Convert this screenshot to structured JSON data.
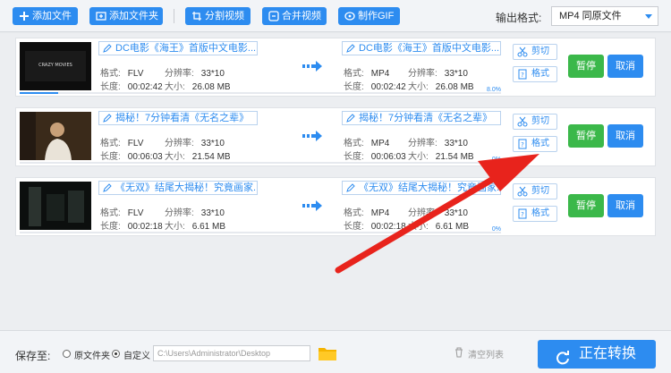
{
  "toolbar": {
    "add_file": "添加文件",
    "add_folder": "添加文件夹",
    "split_video": "分割视频",
    "merge_video": "合并视频",
    "make_gif": "制作GIF",
    "output_format_label": "输出格式:",
    "output_format_value": "MP4  同原文件"
  },
  "labels": {
    "format": "格式:",
    "resolution": "分辨率:",
    "duration": "长度:",
    "size": "大小:",
    "cut": "剪切",
    "format_btn": "格式",
    "pause": "暂停",
    "cancel": "取消"
  },
  "rows": [
    {
      "src_title": "DC电影《海王》首版中文电影...",
      "dst_title": "DC电影《海王》首版中文电影...",
      "src": {
        "format": "FLV",
        "resolution": "33*10",
        "duration": "00:02:42",
        "size": "26.08 MB"
      },
      "dst": {
        "format": "MP4",
        "resolution": "33*10",
        "duration": "00:02:42",
        "size": "26.08 MB"
      },
      "progress_text": "8.0%",
      "progress": 0.08,
      "thumb_caption": "CRAZY MOVIES"
    },
    {
      "src_title": "揭秘！7分钟看清《无名之辈》",
      "dst_title": "揭秘！7分钟看清《无名之辈》",
      "src": {
        "format": "FLV",
        "resolution": "33*10",
        "duration": "00:06:03",
        "size": "21.54 MB"
      },
      "dst": {
        "format": "MP4",
        "resolution": "33*10",
        "duration": "00:06:03",
        "size": "21.54 MB"
      },
      "progress_text": "0%",
      "progress": 0.0,
      "thumb_caption": ""
    },
    {
      "src_title": "《无双》结尾大揭秘！究竟画家.",
      "dst_title": "《无双》结尾大揭秘！究竟画家.",
      "src": {
        "format": "FLV",
        "resolution": "33*10",
        "duration": "00:02:18",
        "size": "6.61 MB"
      },
      "dst": {
        "format": "MP4",
        "resolution": "33*10",
        "duration": "00:02:18",
        "size": "6.61 MB"
      },
      "progress_text": "0%",
      "progress": 0.0,
      "thumb_caption": ""
    }
  ],
  "footer": {
    "save_to": "保存至:",
    "option_source_folder": "原文件夹",
    "option_custom": "自定义",
    "selected_option": "custom",
    "path_value": "C:\\Users\\Administrator\\Desktop",
    "clear_list": "清空列表",
    "convert_button": "正在转换"
  },
  "colors": {
    "accent": "#2d8cf0",
    "pause_green": "#3bb84a",
    "annotation_arrow": "#e8231c"
  },
  "icons": [
    "plus-icon",
    "folder-plus-icon",
    "crop-icon",
    "merge-icon",
    "gif-icon",
    "pencil-icon",
    "right-arrows-icon",
    "scissors-icon",
    "format-icon",
    "folder-icon",
    "trash-icon",
    "refresh-icon"
  ]
}
